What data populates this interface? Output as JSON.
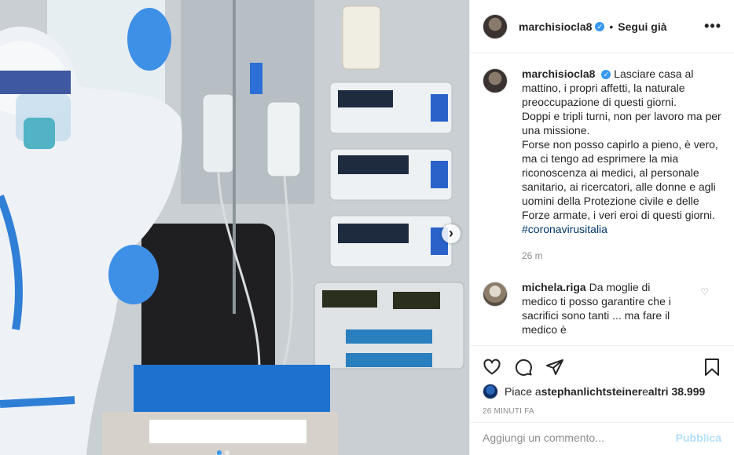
{
  "post": {
    "username": "marchisiocla8",
    "verified_mark": "✓",
    "separator": "•",
    "follow_label": "Segui già",
    "more_label": "•••"
  },
  "caption": {
    "username": "marchisiocla8",
    "text": "Lasciare casa al mattino, i propri affetti, la naturale preoccupazione di questi giorni.\nDoppi e tripli turni, non per lavoro ma per una missione.\nForse non posso capirlo a pieno, è vero, ma ci tengo ad esprimere la mia riconoscenza ai medici, al personale sanitario, ai ricercatori, alle donne e agli uomini della Protezione civile e delle Forze armate, i veri eroi di questi giorni.",
    "hashtag": "#coronavirusitalia",
    "time": "26 m"
  },
  "comment": {
    "username": "michela.riga",
    "text": "Da moglie di medico ti posso garantire che i sacrifici sono tanti ... ma fare il medico è"
  },
  "likes": {
    "prefix": "Piace a ",
    "user": "stephanlichtsteiner",
    "middle": " e ",
    "others": "altri 38.999"
  },
  "timestamp": "26 MINUTI FA",
  "add_comment": {
    "placeholder": "Aggiungi un commento...",
    "publish_label": "Pubblica"
  },
  "media": {
    "next_arrow": "›",
    "slide_count": 2,
    "active_slide": 1
  },
  "icons": [
    "heart-icon",
    "comment-icon",
    "share-icon",
    "bookmark-icon",
    "chevron-right-icon",
    "more-icon",
    "verified-icon"
  ],
  "colors": {
    "link": "#00376b",
    "verified": "#3897f0",
    "publish_disabled": "#b2dffc",
    "meta_text": "#8e8e8e"
  }
}
